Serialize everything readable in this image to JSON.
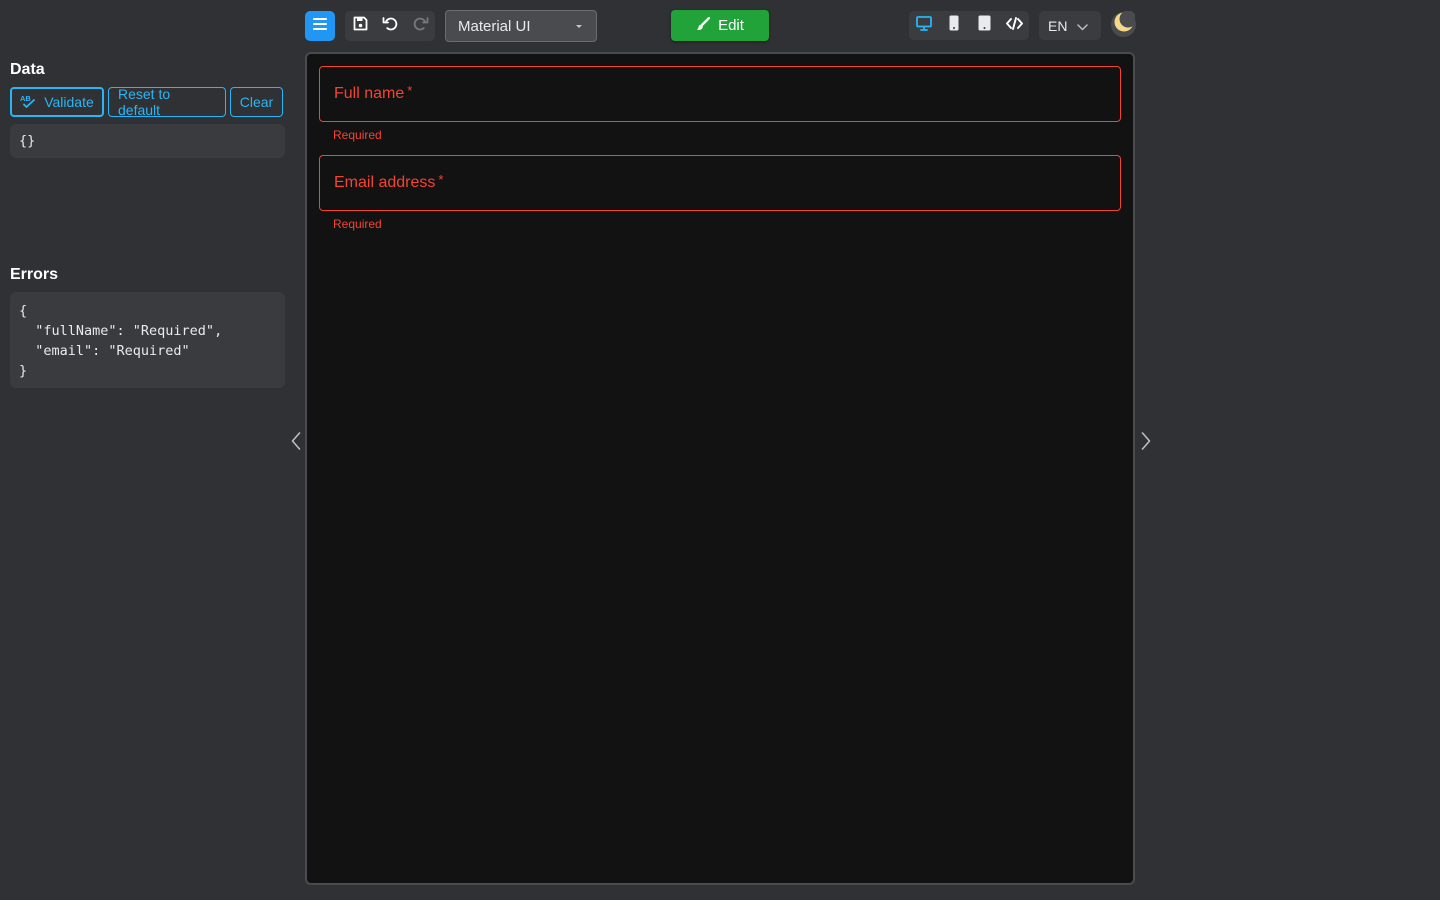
{
  "toolbar": {
    "theme_select_value": "Material UI",
    "edit_label": "Edit",
    "language_value": "EN"
  },
  "data_panel": {
    "title": "Data",
    "validate_label": "Validate",
    "reset_label": "Reset to default",
    "clear_label": "Clear",
    "json_text": "{}"
  },
  "errors_panel": {
    "title": "Errors",
    "json_text": "{\n  \"fullName\": \"Required\",\n  \"email\": \"Required\"\n}"
  },
  "form": {
    "fields": [
      {
        "label": "Full name",
        "required_marker": "*",
        "helper": "Required"
      },
      {
        "label": "Email address",
        "required_marker": "*",
        "helper": "Required"
      }
    ]
  },
  "colors": {
    "accent": "#2196f3",
    "edit_green": "#21a33a",
    "error_red": "#f44336",
    "outline_blue": "#29b6f6"
  },
  "icons": {
    "menu": "hamburger-icon",
    "save": "floppy-disk-icon",
    "undo": "undo-icon",
    "redo": "redo-icon",
    "edit": "paintbrush-icon",
    "desktop": "desktop-icon",
    "mobile": "mobile-icon",
    "tablet": "tablet-icon",
    "code": "code-icon",
    "theme": "moon-icon",
    "validate": "spellcheck-icon",
    "left": "chevron-left-icon",
    "right": "chevron-right-icon"
  }
}
